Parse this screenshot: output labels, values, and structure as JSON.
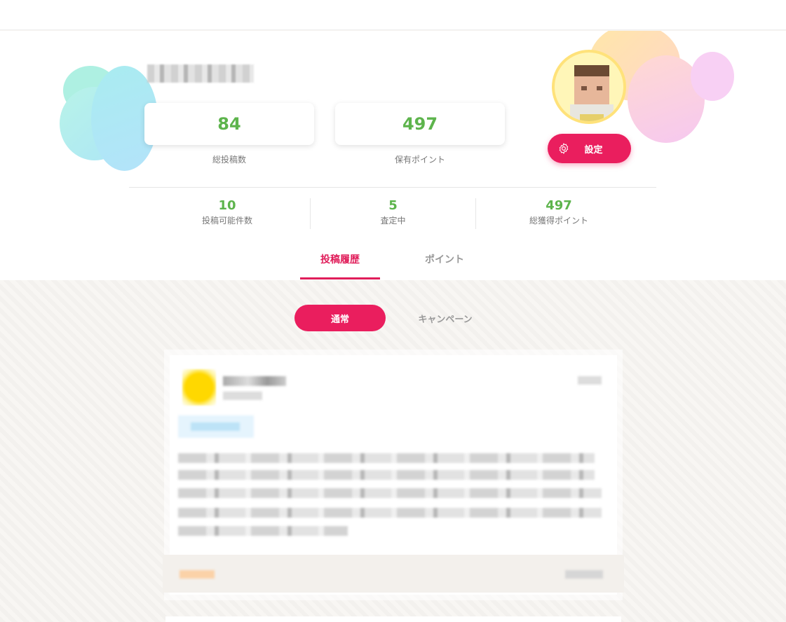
{
  "profile": {
    "stats": {
      "total_posts": "84",
      "total_posts_label": "総投稿数",
      "points_held": "497",
      "points_held_label": "保有ポイント"
    },
    "settings_label": "設定",
    "mini_stats": [
      {
        "value": "10",
        "label": "投稿可能件数"
      },
      {
        "value": "5",
        "label": "査定中"
      },
      {
        "value": "497",
        "label": "総獲得ポイント"
      }
    ]
  },
  "tabs": [
    {
      "label": "投稿履歴",
      "active": true
    },
    {
      "label": "ポイント",
      "active": false
    }
  ],
  "subtabs": [
    {
      "label": "通常",
      "active": true
    },
    {
      "label": "キャンペーン",
      "active": false
    }
  ],
  "icons": {
    "settings": "gear-icon"
  },
  "colors": {
    "accent": "#ea1e5e",
    "stat_green": "#5db44c",
    "tab_active": "#e01d5a"
  }
}
